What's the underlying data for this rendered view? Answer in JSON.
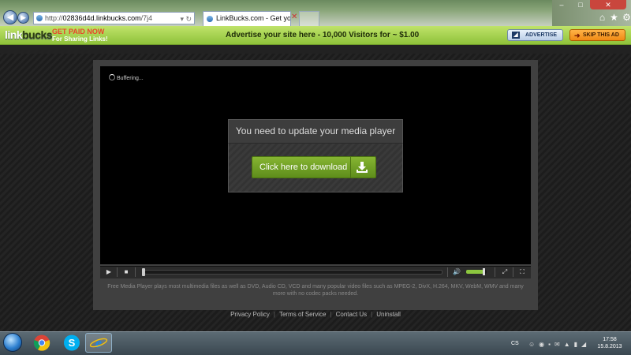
{
  "browser": {
    "url_prefix": "http://",
    "url_host": "02836d4d.linkbucks.com",
    "url_path": "/7j4",
    "tab_title": "LinkBucks.com - Get your s...",
    "window_controls": {
      "min": "–",
      "max": "□",
      "close": "✕"
    }
  },
  "linkbucks_bar": {
    "logo_link": "link",
    "logo_bucks": "bucks",
    "get_paid": "GET PAID NOW",
    "for_sharing": "For Sharing Links!",
    "advert_text": "Advertise your site here - 10,000 Visitors for ~ $1.00",
    "advertise_button": "ADVERTISE",
    "skip_button": "SKIP THIS AD"
  },
  "player": {
    "buffering": "Buffering...",
    "dialog_title": "You need to update your media player",
    "download_button": "Click here to download",
    "progress": 0.0,
    "volume": 0.85,
    "description": "Free Media Player plays most multimedia files as well as DVD, Audio CD, VCD and many popular video files such as MPEG-2, DivX, H.264, MKV, WebM, WMV and many more with no codec packs needed."
  },
  "footer": {
    "links": [
      "Privacy Policy",
      "Terms of Service",
      "Contact Us",
      "Uninstall"
    ]
  },
  "taskbar": {
    "language": "CS",
    "time": "17:58",
    "date": "15.8.2013"
  },
  "colors": {
    "accent_green": "#8cc63f",
    "skip_orange": "#f08a15",
    "get_paid_red": "#e8452a"
  }
}
